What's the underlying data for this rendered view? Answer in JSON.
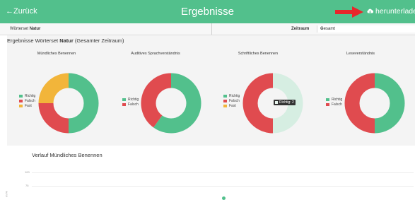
{
  "header": {
    "back_label": "←Zurück",
    "title": "Ergebnisse",
    "download_label": "herunterladen"
  },
  "filter": {
    "left_label": "Wörterset",
    "left_value": "Natur",
    "zeitraum_label": "Zeitraum",
    "zeitraum_value": "Gesamt"
  },
  "panel": {
    "title_prefix": "Ergebnisse Wörterset",
    "title_bold": "Natur",
    "title_suffix": "(Gesamter Zeitraum)"
  },
  "colors": {
    "richtig": "#52c08c",
    "falsch": "#e04b4f",
    "fast": "#f2b53a",
    "highlight": "#d6eee2"
  },
  "charts": [
    {
      "title": "Mündliches Benennen",
      "legend": [
        "Richtig",
        "Falsch",
        "Fast"
      ],
      "chart_data": {
        "type": "pie",
        "categories": [
          "Richtig",
          "Falsch",
          "Fast"
        ],
        "values": [
          50,
          25,
          25
        ]
      }
    },
    {
      "title": "Auditives Sprachverständnis",
      "legend": [
        "Richtig",
        "Falsch"
      ],
      "chart_data": {
        "type": "pie",
        "categories": [
          "Richtig",
          "Falsch"
        ],
        "values": [
          60,
          40
        ]
      }
    },
    {
      "title": "Schriftliches Benennen",
      "legend": [
        "Richtig",
        "Falsch",
        "Fast"
      ],
      "tooltip": "Richtig: 2",
      "chart_data": {
        "type": "pie",
        "categories": [
          "Richtig",
          "Falsch",
          "Fast"
        ],
        "values": [
          2,
          2,
          0
        ]
      }
    },
    {
      "title": "Leseverständnis",
      "legend": [
        "Richtig",
        "Falsch"
      ],
      "chart_data": {
        "type": "pie",
        "categories": [
          "Richtig",
          "Falsch"
        ],
        "values": [
          50,
          50
        ]
      }
    }
  ],
  "verlauf": {
    "title": "Verlauf Mündliches Benennen",
    "yticks": [
      "100",
      "75"
    ],
    "ylabel": "in %"
  }
}
